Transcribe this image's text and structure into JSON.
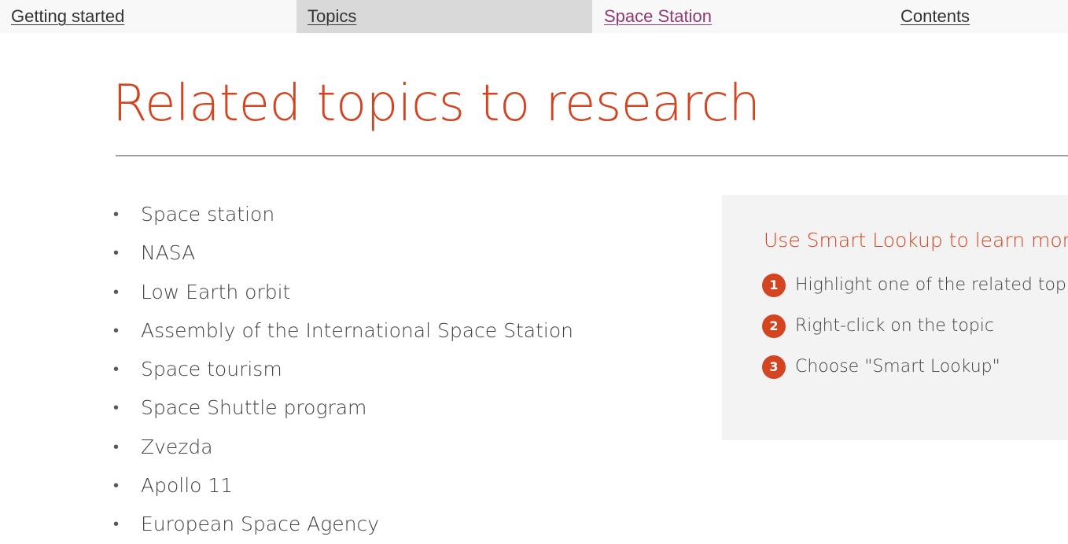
{
  "nav": {
    "tabs": [
      {
        "label": "Getting started"
      },
      {
        "label": "Topics",
        "selected": true
      },
      {
        "label": "Space Station",
        "visited": true
      },
      {
        "label": "Contents"
      }
    ]
  },
  "page": {
    "title": "Related topics to research"
  },
  "topics": [
    "Space station",
    "NASA",
    "Low Earth orbit",
    "Assembly of the International Space Station",
    "Space tourism",
    "Space Shuttle program",
    "Zvezda",
    "Apollo 11",
    "European Space Agency"
  ],
  "smart_lookup": {
    "heading": "Use Smart Lookup to learn more",
    "steps": [
      {
        "number": "1",
        "text": "Highlight one of the related topics"
      },
      {
        "number": "2",
        "text": "Right-click on the topic"
      },
      {
        "number": "3",
        "text": "Choose \"Smart Lookup\""
      }
    ]
  },
  "colors": {
    "accent": "#d34420",
    "selected_tab_bg": "#d9d9d9",
    "visited_link": "#8e3a74",
    "panel_bg": "#f3f3f3"
  }
}
